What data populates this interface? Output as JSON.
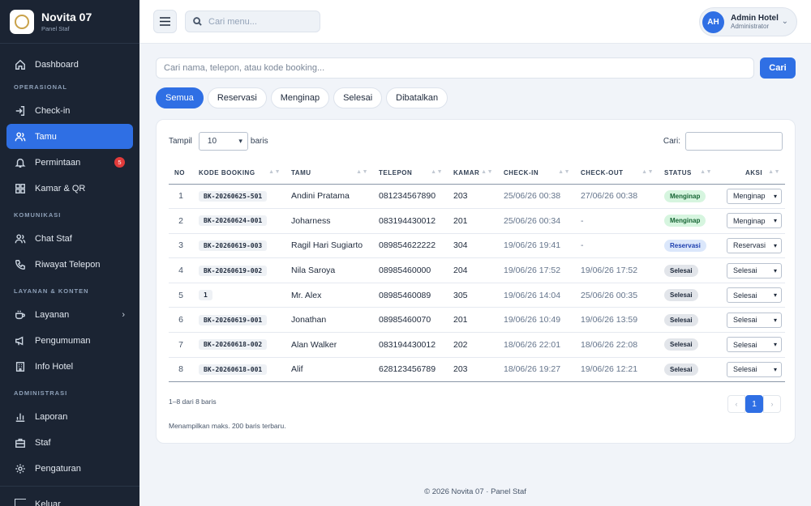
{
  "brand": {
    "name": "Novita 07",
    "subtitle": "Panel Staf"
  },
  "nav": {
    "dashboard": "Dashboard",
    "section_operasional": "OPERASIONAL",
    "checkin": "Check-in",
    "tamu": "Tamu",
    "permintaan": "Permintaan",
    "permintaan_count": "5",
    "kamar": "Kamar & QR",
    "section_komunikasi": "KOMUNIKASI",
    "chat": "Chat Staf",
    "riwayat": "Riwayat Telepon",
    "section_layanan": "LAYANAN & KONTEN",
    "layanan": "Layanan",
    "pengumuman": "Pengumuman",
    "info": "Info Hotel",
    "section_admin": "ADMINISTRASI",
    "laporan": "Laporan",
    "staf": "Staf",
    "pengaturan": "Pengaturan",
    "keluar": "Keluar"
  },
  "topbar": {
    "search_placeholder": "Cari menu...",
    "avatar_initials": "AH",
    "user_name": "Admin Hotel",
    "user_role": "Administrator"
  },
  "search": {
    "placeholder": "Cari nama, telepon, atau kode booking...",
    "button": "Cari"
  },
  "tabs": [
    "Semua",
    "Reservasi",
    "Menginap",
    "Selesai",
    "Dibatalkan"
  ],
  "table_controls": {
    "show_label": "Tampil",
    "page_length": "10",
    "rows_label": "baris",
    "filter_label": "Cari:"
  },
  "columns": [
    "NO",
    "KODE BOOKING",
    "TAMU",
    "TELEPON",
    "KAMAR",
    "CHECK-IN",
    "CHECK-OUT",
    "STATUS",
    "AKSI"
  ],
  "rows": [
    {
      "no": "1",
      "code": "BK-20260625-501",
      "guest": "Andini Pratama",
      "phone": "081234567890",
      "room": "203",
      "checkin": "25/06/26 00:38",
      "checkout": "27/06/26 00:38",
      "status": "Menginap",
      "action": "Menginap"
    },
    {
      "no": "2",
      "code": "BK-20260624-001",
      "guest": "Joharness",
      "phone": "083194430012",
      "room": "201",
      "checkin": "25/06/26 00:34",
      "checkout": "-",
      "status": "Menginap",
      "action": "Menginap"
    },
    {
      "no": "3",
      "code": "BK-20260619-003",
      "guest": "Ragil Hari Sugiarto",
      "phone": "089854622222",
      "room": "304",
      "checkin": "19/06/26 19:41",
      "checkout": "-",
      "status": "Reservasi",
      "action": "Reservasi"
    },
    {
      "no": "4",
      "code": "BK-20260619-002",
      "guest": "Nila Saroya",
      "phone": "08985460000",
      "room": "204",
      "checkin": "19/06/26 17:52",
      "checkout": "19/06/26 17:52",
      "status": "Selesai",
      "action": "Selesai"
    },
    {
      "no": "5",
      "code": "1",
      "guest": "Mr. Alex",
      "phone": "08985460089",
      "room": "305",
      "checkin": "19/06/26 14:04",
      "checkout": "25/06/26 00:35",
      "status": "Selesai",
      "action": "Selesai"
    },
    {
      "no": "6",
      "code": "BK-20260619-001",
      "guest": "Jonathan",
      "phone": "08985460070",
      "room": "201",
      "checkin": "19/06/26 10:49",
      "checkout": "19/06/26 13:59",
      "status": "Selesai",
      "action": "Selesai"
    },
    {
      "no": "7",
      "code": "BK-20260618-002",
      "guest": "Alan Walker",
      "phone": "083194430012",
      "room": "202",
      "checkin": "18/06/26 22:01",
      "checkout": "18/06/26 22:08",
      "status": "Selesai",
      "action": "Selesai"
    },
    {
      "no": "8",
      "code": "BK-20260618-001",
      "guest": "Alif",
      "phone": "628123456789",
      "room": "203",
      "checkin": "18/06/26 19:27",
      "checkout": "19/06/26 12:21",
      "status": "Selesai",
      "action": "Selesai"
    }
  ],
  "footer": {
    "info": "1–8 dari 8 baris",
    "note": "Menampilkan maks. 200 baris terbaru.",
    "current_page": "1",
    "prev": "‹",
    "next": "›"
  },
  "copyright": "© 2026 Novita 07 · Panel Staf",
  "colors": {
    "accent": "#2f6fe4",
    "sidebar": "#1b2433",
    "badge": "#e23b3b"
  }
}
